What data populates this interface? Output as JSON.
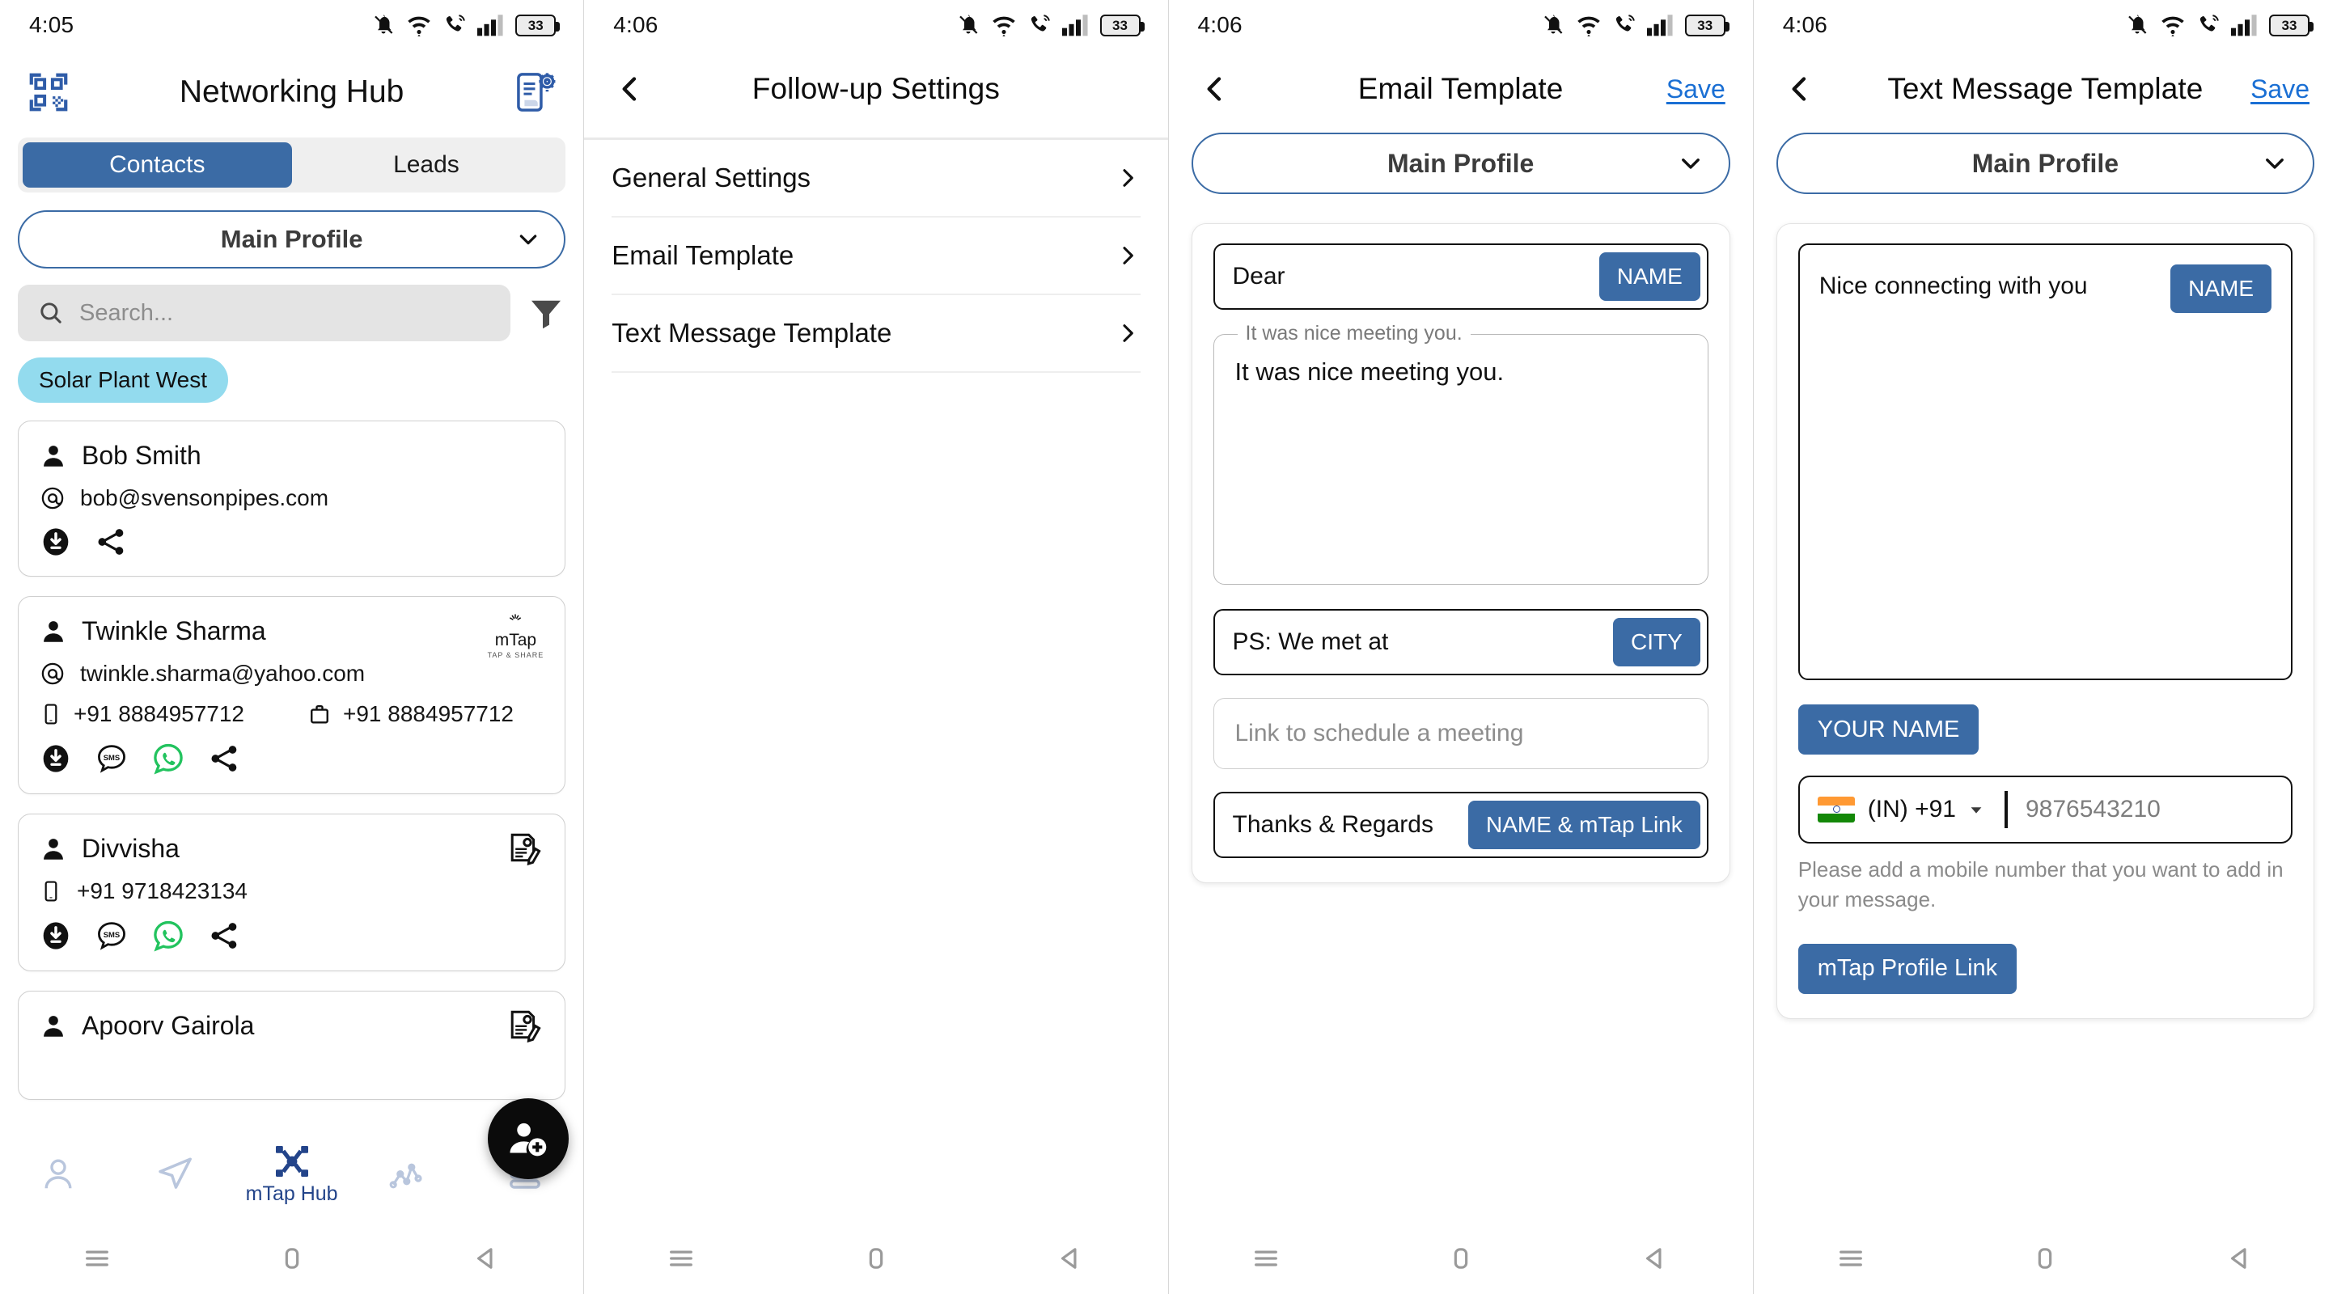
{
  "theme": {
    "accent": "#3b6ba5",
    "link": "#1a6fd4",
    "chip_bg": "#93dbee",
    "nav_active": "#23448a"
  },
  "status_bars": [
    {
      "time": "4:05",
      "battery": "33"
    },
    {
      "time": "4:06",
      "battery": "33"
    },
    {
      "time": "4:06",
      "battery": "33"
    },
    {
      "time": "4:06",
      "battery": "33"
    }
  ],
  "panel1": {
    "title": "Networking Hub",
    "qr_icon": "qr-code-icon",
    "settings_icon": "device-settings-icon",
    "tabs": [
      {
        "label": "Contacts",
        "active": true
      },
      {
        "label": "Leads",
        "active": false
      }
    ],
    "profile_selector": {
      "label": "Main Profile",
      "icon": "chevron-down-icon"
    },
    "search": {
      "placeholder": "Search...",
      "value": "",
      "icon": "search-icon"
    },
    "filter_icon": "filter-icon",
    "chips": [
      "Solar Plant West"
    ],
    "contacts": [
      {
        "name": "Bob Smith",
        "email": "bob@svensonpipes.com",
        "mobile": "",
        "work": "",
        "badge": "",
        "actions": [
          "download-icon",
          "share-icon"
        ]
      },
      {
        "name": "Twinkle Sharma",
        "email": "twinkle.sharma@yahoo.com",
        "mobile": "+91 8884957712",
        "work": "+91 8884957712",
        "badge": "mtap-logo",
        "badge_text": "mTap",
        "badge_sub": "TAP & SHARE",
        "actions": [
          "download-icon",
          "sms-icon",
          "whatsapp-icon",
          "share-icon"
        ]
      },
      {
        "name": "Divvisha",
        "email": "",
        "mobile": "+91 9718423134",
        "work": "",
        "badge": "edit-contact-icon",
        "actions": [
          "download-icon",
          "sms-icon",
          "whatsapp-icon",
          "share-icon"
        ]
      },
      {
        "name": "Apoorv Gairola",
        "email": "",
        "mobile": "",
        "work": "",
        "badge": "edit-contact-icon",
        "actions": []
      }
    ],
    "fab": "add-contact-icon",
    "bottom_nav": [
      {
        "icon": "person-icon",
        "label": "",
        "active": false
      },
      {
        "icon": "send-icon",
        "label": "",
        "active": false
      },
      {
        "icon": "mtap-hub-icon",
        "label": "mTap Hub",
        "active": true
      },
      {
        "icon": "analytics-icon",
        "label": "",
        "active": false
      },
      {
        "icon": "menu-list-icon",
        "label": "",
        "active": false
      }
    ]
  },
  "panel2": {
    "title": "Follow-up Settings",
    "back_icon": "back-chevron-icon",
    "rows": [
      {
        "label": "General Settings",
        "chevron": "chevron-right-icon"
      },
      {
        "label": "Email Template",
        "chevron": "chevron-right-icon"
      },
      {
        "label": "Text Message Template",
        "chevron": "chevron-right-icon"
      }
    ]
  },
  "panel3": {
    "title": "Email Template",
    "back_icon": "back-chevron-icon",
    "save_label": "Save",
    "profile_selector": {
      "label": "Main Profile",
      "icon": "chevron-down-icon"
    },
    "greeting": {
      "value": "Dear",
      "tag": "NAME"
    },
    "body": {
      "legend": "It was nice meeting you.",
      "value": "It was nice meeting you."
    },
    "ps": {
      "value": "PS: We met at",
      "tag": "CITY"
    },
    "meeting_link": {
      "value": "",
      "placeholder": "Link to schedule a meeting"
    },
    "signoff": {
      "value": "Thanks & Regards",
      "tag": "NAME & mTap Link"
    }
  },
  "panel4": {
    "title": "Text Message Template",
    "back_icon": "back-chevron-icon",
    "save_label": "Save",
    "profile_selector": {
      "label": "Main Profile",
      "icon": "chevron-down-icon"
    },
    "message": {
      "value": "Nice connecting with you",
      "tag": "NAME"
    },
    "your_name_button": "YOUR NAME",
    "phone": {
      "country_flag": "india-flag-icon",
      "country_code": "(IN) +91",
      "caret": "caret-down-icon",
      "number_placeholder": "9876543210",
      "value": ""
    },
    "helper_text": "Please add a mobile number that you want to add in your message.",
    "profile_link_button": "mTap Profile Link"
  },
  "android_nav": {
    "menu": "menu-icon",
    "home": "home-icon",
    "back": "back-triangle-icon"
  }
}
